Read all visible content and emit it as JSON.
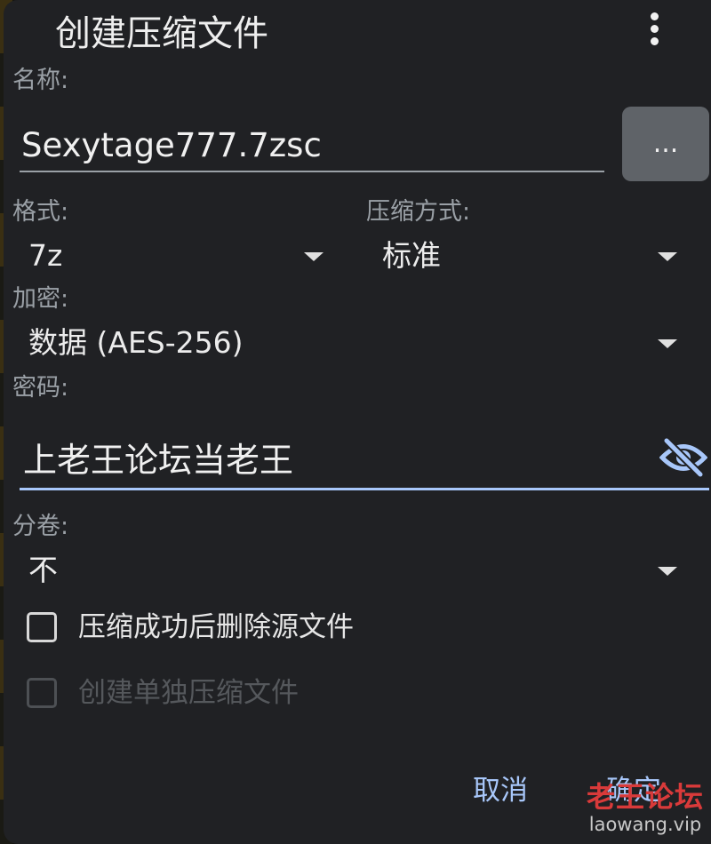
{
  "dialog": {
    "title": "创建压缩文件",
    "menu_icon": "more-vert-icon"
  },
  "name": {
    "label": "名称:",
    "value": "Sexytage777.7zsc",
    "browse_label": "..."
  },
  "format": {
    "label": "格式:",
    "value": "7z"
  },
  "compression": {
    "label": "压缩方式:",
    "value": "标准"
  },
  "encryption": {
    "label": "加密:",
    "value": "数据 (AES-256)"
  },
  "password": {
    "label": "密码:",
    "value": "上老王论坛当老王",
    "visibility_icon": "eye-off-icon"
  },
  "split": {
    "label": "分卷:",
    "value": "不"
  },
  "options": {
    "delete_source": {
      "label": "压缩成功后删除源文件",
      "checked": false,
      "enabled": true
    },
    "separate_archives": {
      "label": "创建单独压缩文件",
      "checked": false,
      "enabled": false
    }
  },
  "buttons": {
    "cancel": "取消",
    "ok": "确定"
  },
  "watermark": {
    "top": "老王论坛",
    "bottom": "laowang.vip"
  },
  "colors": {
    "dialog_bg": "#202124",
    "accent": "#a8c7fa",
    "watermark_red": "#d93a3a"
  }
}
